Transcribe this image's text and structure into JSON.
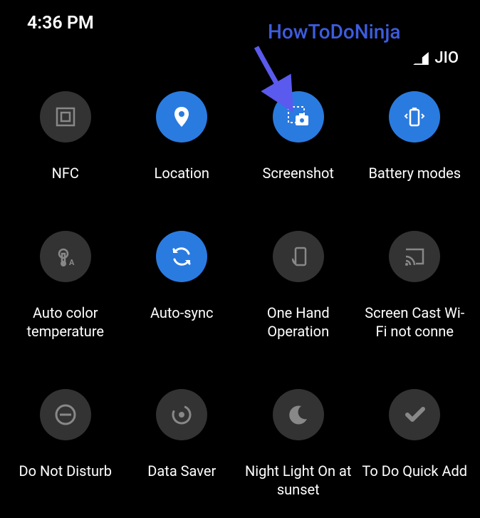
{
  "status": {
    "time": "4:36 PM",
    "carrier": "JIO"
  },
  "watermark": {
    "text": "HowToDoNinja"
  },
  "tiles": [
    {
      "label": "NFC",
      "active": false,
      "icon": "nfc"
    },
    {
      "label": "Location",
      "active": true,
      "icon": "location"
    },
    {
      "label": "Screenshot",
      "active": true,
      "icon": "screenshot"
    },
    {
      "label": "Battery modes",
      "active": true,
      "icon": "battery"
    },
    {
      "label": "Auto color temperature",
      "active": false,
      "icon": "autocolor"
    },
    {
      "label": "Auto-sync",
      "active": true,
      "icon": "sync"
    },
    {
      "label": "One Hand Operation",
      "active": false,
      "icon": "onehand"
    },
    {
      "label": "Screen Cast Wi-Fi not conne",
      "active": false,
      "icon": "cast"
    },
    {
      "label": "Do Not Disturb",
      "active": false,
      "icon": "dnd"
    },
    {
      "label": "Data Saver",
      "active": false,
      "icon": "datasaver"
    },
    {
      "label": "Night Light On at sunset",
      "active": false,
      "icon": "nightlight"
    },
    {
      "label": "To Do Quick Add",
      "active": false,
      "icon": "todo"
    }
  ],
  "colors": {
    "active": "#2a7be0",
    "inactive": "#333333",
    "watermark": "#3d5cde"
  }
}
